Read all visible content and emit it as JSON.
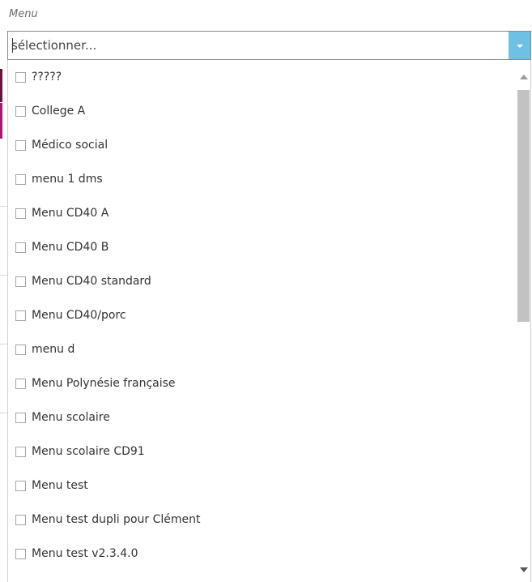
{
  "field": {
    "label": "Menu",
    "placeholder": "sélectionner..."
  },
  "dropdown": {
    "icon": "chevron-down-icon",
    "accent_color": "#6ec1e4"
  },
  "options": [
    {
      "label": "?????"
    },
    {
      "label": "College A"
    },
    {
      "label": "Médico social"
    },
    {
      "label": "menu 1 dms"
    },
    {
      "label": "Menu CD40 A"
    },
    {
      "label": "Menu CD40 B"
    },
    {
      "label": "Menu CD40 standard"
    },
    {
      "label": "Menu CD40/porc"
    },
    {
      "label": "menu d"
    },
    {
      "label": "Menu Polynésie française"
    },
    {
      "label": "Menu scolaire"
    },
    {
      "label": "Menu scolaire CD91"
    },
    {
      "label": "Menu test"
    },
    {
      "label": "Menu test dupli pour Clément"
    },
    {
      "label": "Menu test v2.3.4.0"
    }
  ],
  "background_accents": {
    "primary": "#6b1040",
    "secondary": "#a8166f"
  }
}
